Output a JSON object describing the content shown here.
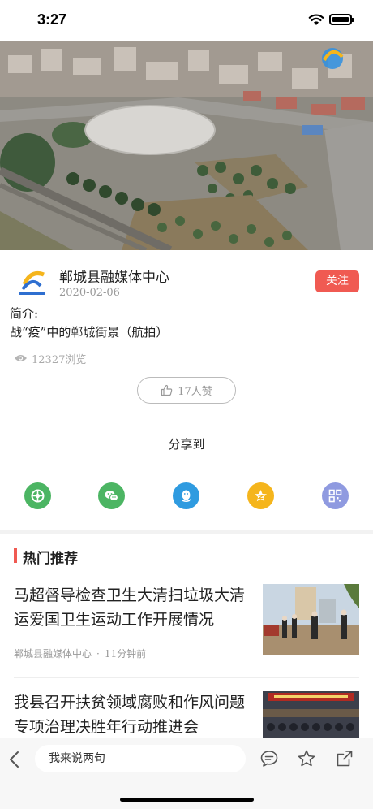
{
  "status": {
    "time": "3:27"
  },
  "publisher": {
    "name": "郸城县融媒体中心",
    "date": "2020-02-06",
    "follow_label": "关注"
  },
  "intro": {
    "label": "简介:",
    "text": "战“疫”中的郸城街景（航拍）"
  },
  "stats": {
    "views": "12327浏览",
    "likes": "17人赞"
  },
  "share": {
    "title": "分享到",
    "targets": [
      {
        "icon": "moments-icon",
        "color": "#4cb563"
      },
      {
        "icon": "wechat-icon",
        "color": "#4cb563"
      },
      {
        "icon": "qq-icon",
        "color": "#2f9be0"
      },
      {
        "icon": "qzone-icon",
        "color": "#f5b51c"
      },
      {
        "icon": "qrcode-icon",
        "color": "#8f9ae0"
      }
    ]
  },
  "hot": {
    "title": "热门推荐",
    "items": [
      {
        "title": "马超督导检查卫生大清扫垃圾大清运爱国卫生运动工作开展情况",
        "source": "郸城县融媒体中心",
        "time": "11分钟前"
      },
      {
        "title": "我县召开扶贫领域腐败和作风问题专项治理决胜年行动推进会"
      }
    ]
  },
  "comment": {
    "placeholder": "我来说两句"
  },
  "colors": {
    "accent": "#f05a52"
  }
}
